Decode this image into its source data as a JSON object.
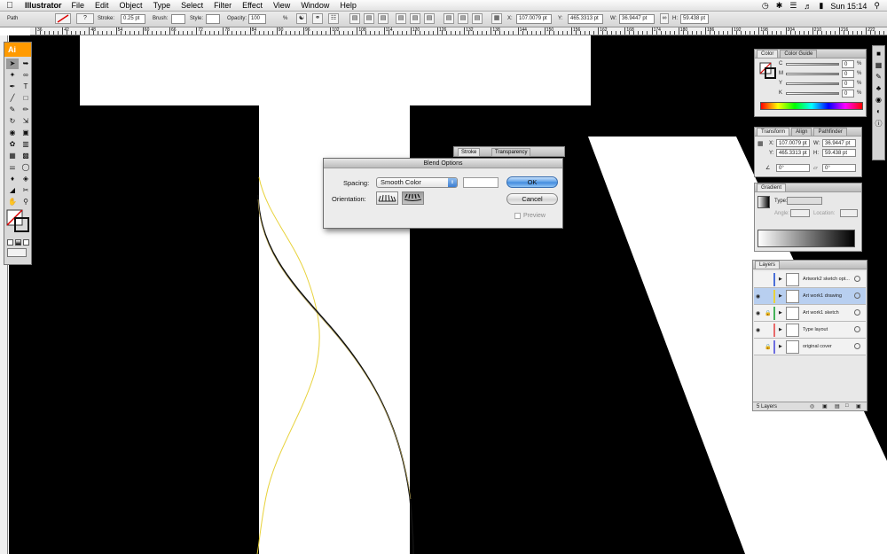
{
  "menubar": {
    "app": "Illustrator",
    "items": [
      "File",
      "Edit",
      "Object",
      "Type",
      "Select",
      "Filter",
      "Effect",
      "View",
      "Window",
      "Help"
    ],
    "clock": "Sun 15:14"
  },
  "control_bar": {
    "selection": "Path",
    "stroke_label": "Stroke:",
    "stroke_value": "0.25 pt",
    "brush_label": "Brush:",
    "style_label": "Style:",
    "opacity_label": "Opacity:",
    "opacity_value": "100",
    "opacity_unit": "%",
    "x_label": "X:",
    "x_value": "107.0079 pt",
    "y_label": "Y:",
    "y_value": "465.3313 pt",
    "w_label": "W:",
    "w_value": "36.9447 pt",
    "h_label": "H:",
    "h_value": "59.438 pt"
  },
  "ruler": {
    "labels": [
      "36",
      "42",
      "48",
      "54",
      "60",
      "66",
      "72",
      "78",
      "84",
      "90",
      "96",
      "102",
      "108",
      "114",
      "120",
      "126",
      "132",
      "138",
      "144",
      "150",
      "156",
      "162",
      "168",
      "174",
      "180",
      "186",
      "192",
      "198",
      "204",
      "210",
      "216",
      "222",
      "228"
    ]
  },
  "tools": {
    "logo": "Ai"
  },
  "color_panel": {
    "tabs": [
      "Color",
      "Color Guide"
    ],
    "channels": [
      {
        "label": "C",
        "value": "0"
      },
      {
        "label": "M",
        "value": "0"
      },
      {
        "label": "Y",
        "value": "0"
      },
      {
        "label": "K",
        "value": "0"
      }
    ],
    "unit": "%"
  },
  "transform_panel": {
    "tabs": [
      "Transform",
      "Align",
      "Pathfinder"
    ],
    "x_label": "X:",
    "x_value": "107.0079 pt",
    "y_label": "Y:",
    "y_value": "465.3313 pt",
    "w_label": "W:",
    "w_value": "36.9447 pt",
    "h_label": "H:",
    "h_value": "59.438 pt",
    "angle_value": "0°",
    "shear_value": "0°"
  },
  "gradient_panel": {
    "tab": "Gradient",
    "type_label": "Type:",
    "angle_label": "Angle:",
    "location_label": "Location:"
  },
  "stroke_panel": {
    "tabs": [
      "Stroke",
      "Transparency"
    ]
  },
  "layers_panel": {
    "tab": "Layers",
    "layers": [
      {
        "name": "Artwork2 sketch opt...",
        "color": "#4a6fd8",
        "visible": false,
        "locked": false,
        "selected": false
      },
      {
        "name": "Art work1 drawing",
        "color": "#e8d23a",
        "visible": true,
        "locked": false,
        "selected": true
      },
      {
        "name": "Art work1 sketch",
        "color": "#44b25a",
        "visible": true,
        "locked": true,
        "selected": false
      },
      {
        "name": "Type layout",
        "color": "#e86a6a",
        "visible": true,
        "locked": false,
        "selected": false
      },
      {
        "name": "original cover",
        "color": "#6d6de0",
        "visible": false,
        "locked": true,
        "selected": false
      }
    ],
    "footer": "5 Layers"
  },
  "blend_dialog": {
    "title": "Blend Options",
    "spacing_label": "Spacing:",
    "spacing_value": "Smooth Color",
    "orientation_label": "Orientation:",
    "ok_label": "OK",
    "cancel_label": "Cancel",
    "preview_label": "Preview",
    "preview_checked": false
  }
}
